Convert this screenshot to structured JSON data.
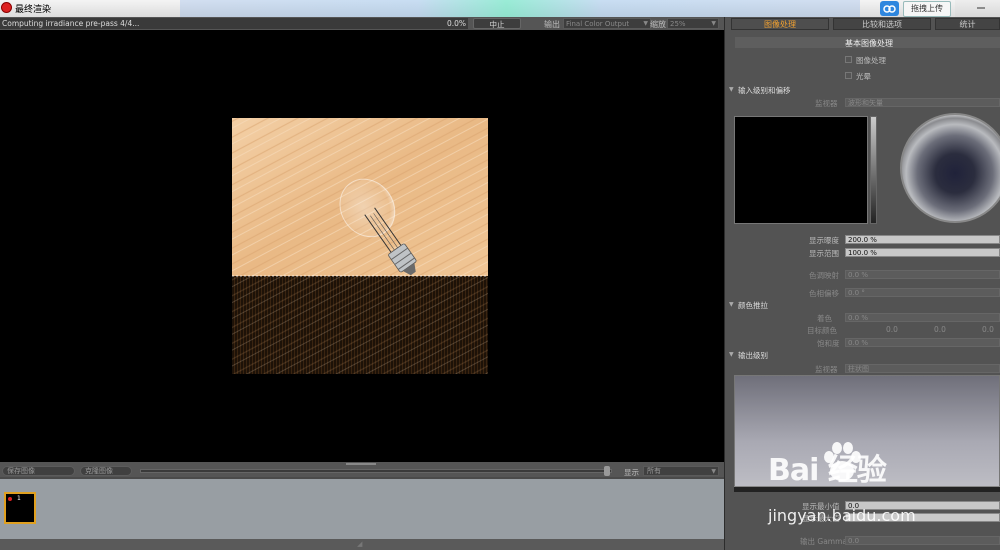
{
  "window": {
    "title": "最终渲染"
  },
  "upload": {
    "label": "拖拽上传"
  },
  "render_bar": {
    "status": "Computing irradiance pre-pass 4/4...",
    "progress_pct": "0.0%",
    "progress_fraction": 0.0,
    "stop": "中止",
    "output_label": "输出",
    "output_value": "Final Color Output",
    "zoom_label": "缩放",
    "zoom_value": "25%"
  },
  "bottom": {
    "save_image": "保存图像",
    "clone_image": "克隆图像",
    "display_label": "显示",
    "display_value": "所有",
    "history": [
      {
        "index": "1"
      }
    ]
  },
  "right_panel": {
    "tabs": [
      "图像处理",
      "比较和选项",
      "统计"
    ],
    "basic_processing": "基本图像处理",
    "checkboxes": [
      "图像处理",
      "光晕"
    ],
    "input_levels": {
      "title": "输入级别和偏移",
      "monitor_label": "监视器",
      "monitor_value": "波形和矢量",
      "exposure_label": "显示曝度",
      "exposure_value": "200.0 %",
      "range_label": "显示范围",
      "range_value": "100.0 %",
      "tone_label": "色调映射",
      "tone_value": "0.0 %",
      "hue_label": "色相偏移",
      "hue_value": "0.0 °"
    },
    "color_push": {
      "title": "颜色推拉",
      "tint_label": "着色",
      "tint_value": "0.0 %",
      "target_label": "目标颜色",
      "target_values": [
        "0.0",
        "0.0",
        "0.0"
      ],
      "saturation_label": "饱和度",
      "saturation_value": "0.0 %"
    },
    "output_levels": {
      "title": "输出级别",
      "monitor_label": "监视器",
      "monitor_value": "柱状图",
      "min_label": "显示最小值",
      "min_value": "0.0",
      "max_label": "显示最大值",
      "gamma_label": "输出 Gamma",
      "gamma_value": "0.0"
    }
  },
  "watermark": {
    "logo": "Bai 经验",
    "url": "jingyan.baidu.com"
  },
  "colors": {
    "accent_tab": "#f0a030",
    "history_border": "#e0a020",
    "viewport": "#000000"
  },
  "icons": [
    "app-logo-icon",
    "cloud-upload-icon",
    "window-controls-icon"
  ]
}
